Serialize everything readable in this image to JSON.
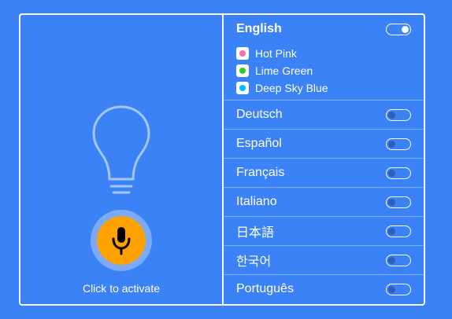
{
  "left": {
    "caption": "Click to activate"
  },
  "english": {
    "label": "English",
    "enabled": true,
    "colors": [
      {
        "label": "Hot Pink",
        "color": "#ff69b4"
      },
      {
        "label": "Lime Green",
        "color": "#32cd32"
      },
      {
        "label": "Deep Sky Blue",
        "color": "#00bfff"
      }
    ]
  },
  "languages": [
    {
      "label": "Deutsch",
      "enabled": false
    },
    {
      "label": "Español",
      "enabled": false
    },
    {
      "label": "Français",
      "enabled": false
    },
    {
      "label": "Italiano",
      "enabled": false
    },
    {
      "label": "日本語",
      "enabled": false
    },
    {
      "label": "한국어",
      "enabled": false
    },
    {
      "label": "Português",
      "enabled": false
    }
  ],
  "colors": {
    "background": "#3b82f6",
    "mic": "#ffa200"
  }
}
